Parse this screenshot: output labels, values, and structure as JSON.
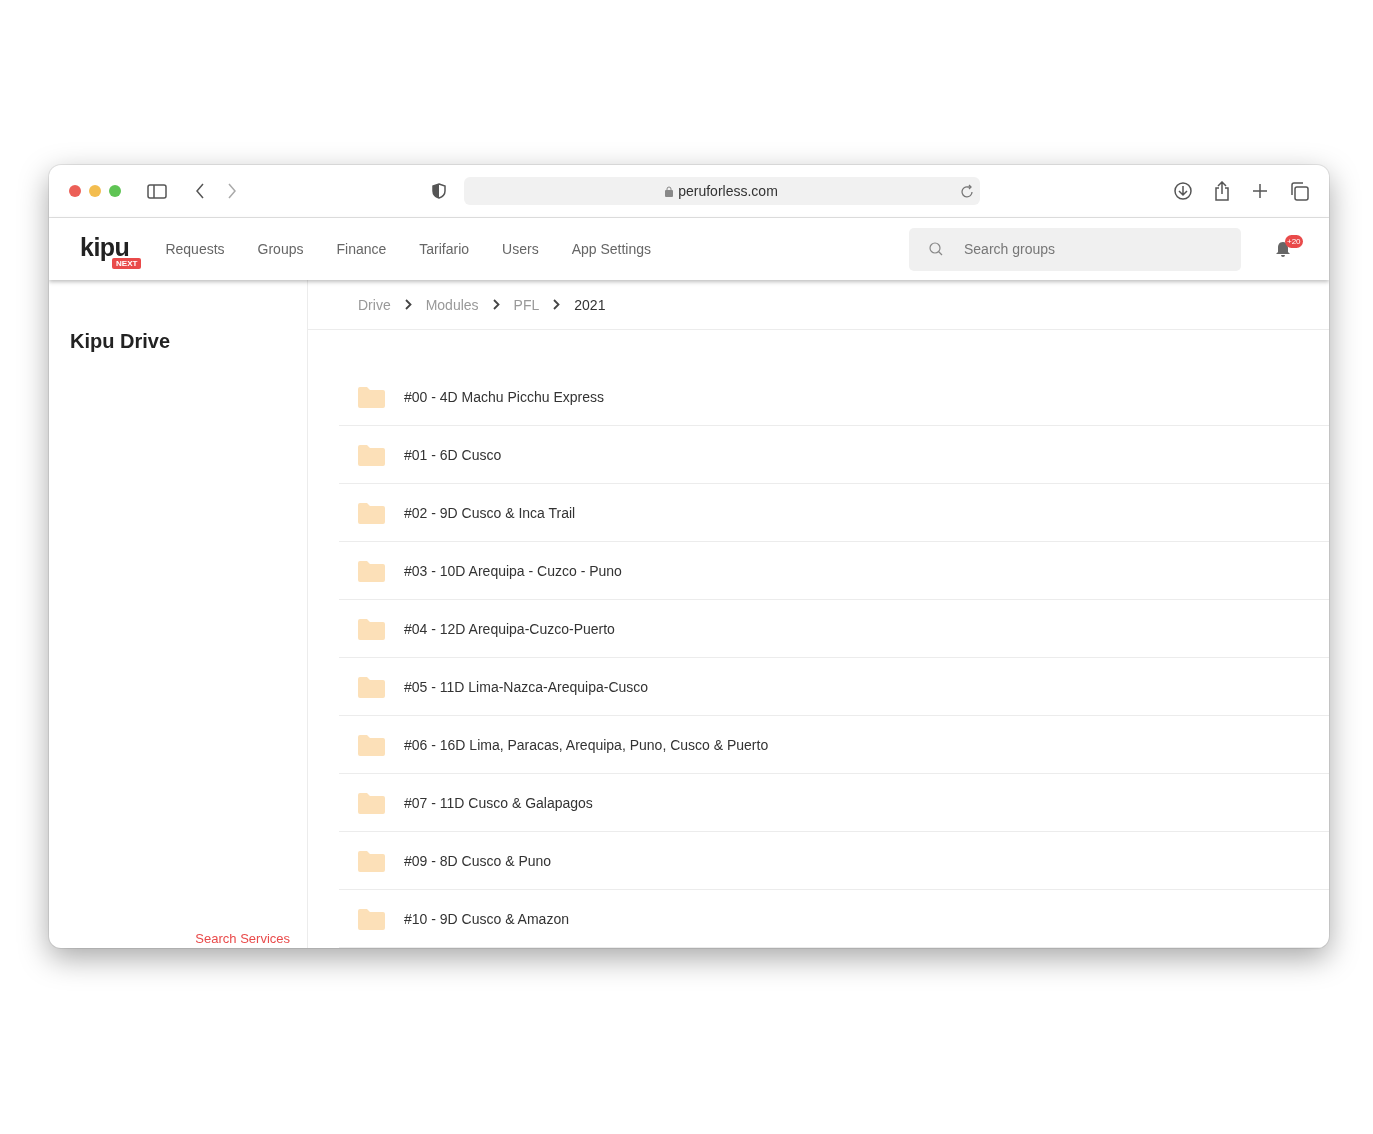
{
  "browser": {
    "url": "peruforless.com"
  },
  "header": {
    "logo": "kipu",
    "logo_badge": "NEXT",
    "nav": [
      "Requests",
      "Groups",
      "Finance",
      "Tarifario",
      "Users",
      "App Settings"
    ],
    "search": {
      "placeholder": "Search groups"
    },
    "notification_count": "+20"
  },
  "sidebar": {
    "title": "Kipu Drive",
    "footer_link": "Search Services"
  },
  "breadcrumb": [
    {
      "label": "Drive",
      "current": false
    },
    {
      "label": "Modules",
      "current": false
    },
    {
      "label": "PFL",
      "current": false
    },
    {
      "label": "2021",
      "current": true
    }
  ],
  "folders": [
    {
      "name": "#00 - 4D Machu Picchu Express"
    },
    {
      "name": "#01 - 6D Cusco"
    },
    {
      "name": "#02 - 9D Cusco & Inca Trail"
    },
    {
      "name": "#03 - 10D Arequipa - Cuzco - Puno"
    },
    {
      "name": "#04 - 12D Arequipa-Cuzco-Puerto"
    },
    {
      "name": "#05 - 11D Lima-Nazca-Arequipa-Cusco"
    },
    {
      "name": "#06 - 16D Lima, Paracas, Arequipa, Puno, Cusco & Puerto"
    },
    {
      "name": "#07 - 11D Cusco & Galapagos"
    },
    {
      "name": "#09 - 8D Cusco & Puno"
    },
    {
      "name": "#10 - 9D Cusco & Amazon"
    }
  ]
}
